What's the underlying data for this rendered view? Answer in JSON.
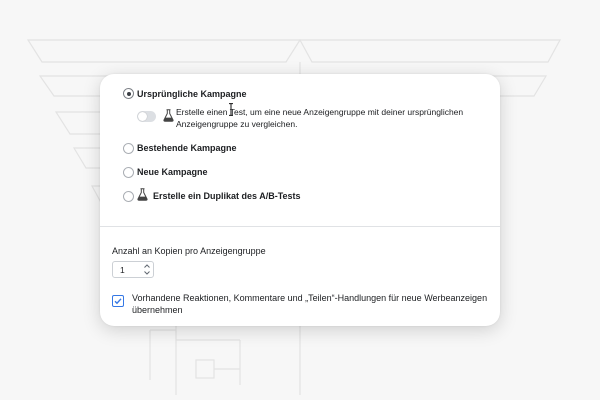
{
  "options": [
    {
      "label": "Ursprüngliche Kampagne",
      "selected": true
    },
    {
      "label": "Bestehende Kampagne",
      "selected": false
    },
    {
      "label": "Neue Kampagne",
      "selected": false
    },
    {
      "label": "Erstelle ein Duplikat des A/B-Tests",
      "selected": false
    }
  ],
  "test_toggle": {
    "on": false,
    "text": "Erstelle einen Test, um eine neue Anzeigengruppe mit deiner ursprünglichen\nAnzeigengruppe zu vergleichen."
  },
  "copies": {
    "label": "Anzahl an Kopien pro Anzeigengruppe",
    "value": "1"
  },
  "engagement_checkbox": {
    "checked": true,
    "text": "Vorhandene Reaktionen, Kommentare und „Teilen“-Handlungen für neue Werbeanzeigen\nübernehmen"
  },
  "colors": {
    "accent": "#3578e5",
    "text": "#1c1e21",
    "background": "#f7f7f7"
  },
  "icons": [
    "flask-icon",
    "text-cursor-icon",
    "chevron-up-icon",
    "chevron-down-icon",
    "checkmark-icon"
  ]
}
